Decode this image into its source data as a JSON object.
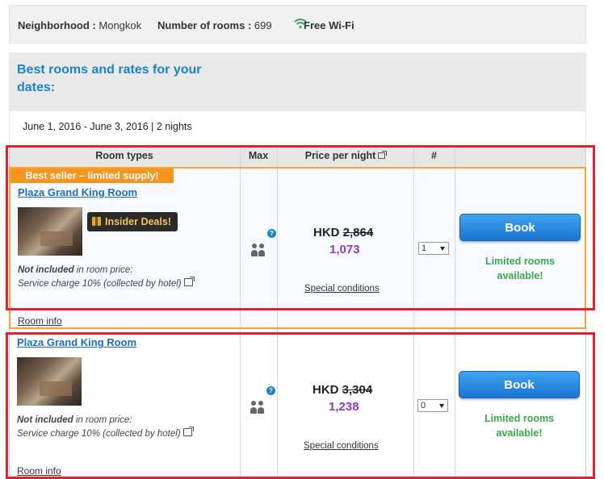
{
  "hotel_info": {
    "neighborhood_label": "Neighborhood :",
    "neighborhood_value": "Mongkok",
    "rooms_label": "Number of rooms :",
    "rooms_value": "699",
    "wifi_label": "Free Wi-Fi"
  },
  "heading": "Best rooms and rates for your dates:",
  "dates": "June 1, 2016 - June 3, 2016 | 2 nights",
  "table_headers": {
    "room_types": "Room types",
    "max": "Max",
    "price": "Price per night",
    "count": "#"
  },
  "rooms": [
    {
      "badge": "Best seller – limited supply!",
      "name": "Plaza Grand King Room",
      "deal": "Insider Deals!",
      "not_included": "Not included",
      "not_included_rest": " in room price:",
      "service_charge": "Service charge 10% (collected by hotel)",
      "room_info": "Room info",
      "currency": "HKD",
      "old_price": "2,864",
      "new_price": "1,073",
      "special": "Special conditions",
      "qty": "1",
      "book": "Book",
      "availability_1": "Limited rooms",
      "availability_2": "available!"
    },
    {
      "name": "Plaza Grand King Room",
      "not_included": "Not included",
      "not_included_rest": " in room price:",
      "service_charge": "Service charge 10% (collected by hotel)",
      "room_info": "Room info",
      "currency": "HKD",
      "old_price": "3,304",
      "new_price": "1,238",
      "special": "Special conditions",
      "qty": "0",
      "book": "Book",
      "availability_1": "Limited rooms",
      "availability_2": "available!"
    }
  ],
  "colors": {
    "accent_blue": "#1b82cf",
    "badge_orange": "#f7941d",
    "price_purple": "#8e3ac0",
    "availability_green": "#3aa84a",
    "highlight_red": "#e3202f"
  }
}
